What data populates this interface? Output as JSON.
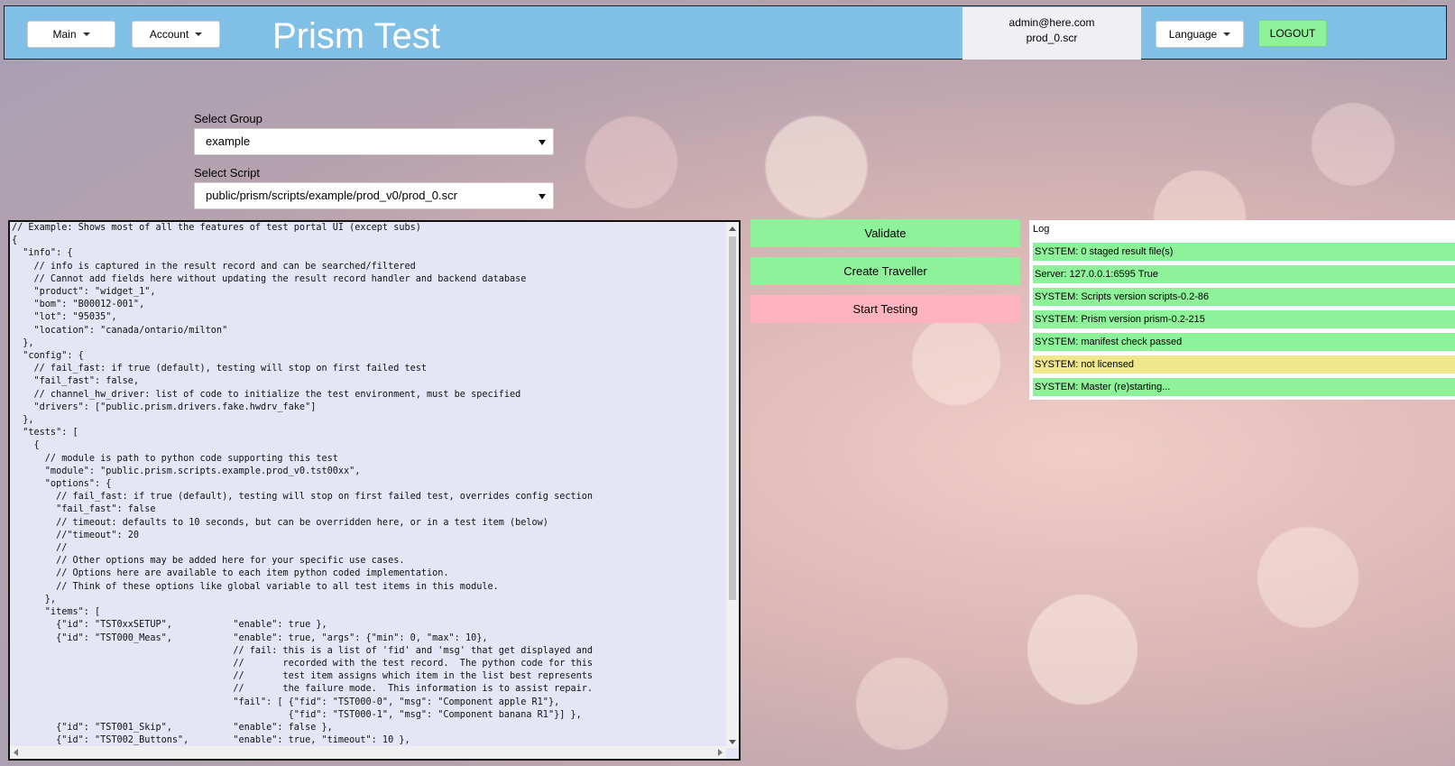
{
  "header": {
    "main_menu": "Main",
    "account_menu": "Account",
    "title": "Prism Test",
    "user_email": "admin@here.com",
    "user_script": "prod_0.scr",
    "language_menu": "Language",
    "logout": "LOGOUT"
  },
  "form": {
    "group_label": "Select Group",
    "group_value": "example",
    "script_label": "Select Script",
    "script_value": "public/prism/scripts/example/prod_v0/prod_0.scr"
  },
  "editor": {
    "lines": [
      "// Example: Shows most of all the features of test portal UI (except subs)",
      "{",
      "  \"info\": {",
      "    // info is captured in the result record and can be searched/filtered",
      "    // Cannot add fields here without updating the result record handler and backend database",
      "    \"product\": \"widget_1\",",
      "    \"bom\": \"B00012-001\",",
      "    \"lot\": \"95035\",",
      "    \"location\": \"canada/ontario/milton\"",
      "  },",
      "  \"config\": {",
      "    // fail_fast: if true (default), testing will stop on first failed test",
      "    \"fail_fast\": false,",
      "    // channel_hw_driver: list of code to initialize the test environment, must be specified",
      "    \"drivers\": [\"public.prism.drivers.fake.hwdrv_fake\"]",
      "  },",
      "  \"tests\": [",
      "    {",
      "      // module is path to python code supporting this test",
      "      \"module\": \"public.prism.scripts.example.prod_v0.tst00xx\",",
      "      \"options\": {",
      "        // fail_fast: if true (default), testing will stop on first failed test, overrides config section",
      "        \"fail_fast\": false",
      "        // timeout: defaults to 10 seconds, but can be overridden here, or in a test item (below)",
      "        //\"timeout\": 20",
      "        //",
      "        // Other options may be added here for your specific use cases.",
      "        // Options here are available to each item python coded implementation.",
      "        // Think of these options like global variable to all test items in this module.",
      "      },",
      "      \"items\": [",
      "        {\"id\": \"TST0xxSETUP\",           \"enable\": true },",
      "        {\"id\": \"TST000_Meas\",           \"enable\": true, \"args\": {\"min\": 0, \"max\": 10},",
      "                                        // fail: this is a list of 'fid' and 'msg' that get displayed and",
      "                                        //       recorded with the test record.  The python code for this",
      "                                        //       test item assigns which item in the list best represents",
      "                                        //       the failure mode.  This information is to assist repair.",
      "                                        \"fail\": [ {\"fid\": \"TST000-0\", \"msg\": \"Component apple R1\"},",
      "                                                  {\"fid\": \"TST000-1\", \"msg\": \"Component banana R1\"}] },",
      "        {\"id\": \"TST001_Skip\",           \"enable\": false },",
      "        {\"id\": \"TST002_Buttons\",        \"enable\": true, \"timeout\": 10 },"
    ]
  },
  "actions": {
    "validate": "Validate",
    "create_traveller": "Create Traveller",
    "start_testing": "Start Testing"
  },
  "log": {
    "title": "Log",
    "entries": [
      {
        "text": "SYSTEM: 0 staged result file(s)",
        "color": "#8ef29a"
      },
      {
        "text": "Server: 127.0.0.1:6595 True",
        "color": "#8ef29a"
      },
      {
        "text": "SYSTEM: Scripts version scripts-0.2-86",
        "color": "#8ef29a"
      },
      {
        "text": "SYSTEM: Prism version prism-0.2-215",
        "color": "#8ef29a"
      },
      {
        "text": "SYSTEM: manifest check passed",
        "color": "#8ef29a"
      },
      {
        "text": "SYSTEM: not licensed",
        "color": "#f0e68c"
      },
      {
        "text": "SYSTEM: Master (re)starting...",
        "color": "#8ef29a"
      }
    ]
  }
}
